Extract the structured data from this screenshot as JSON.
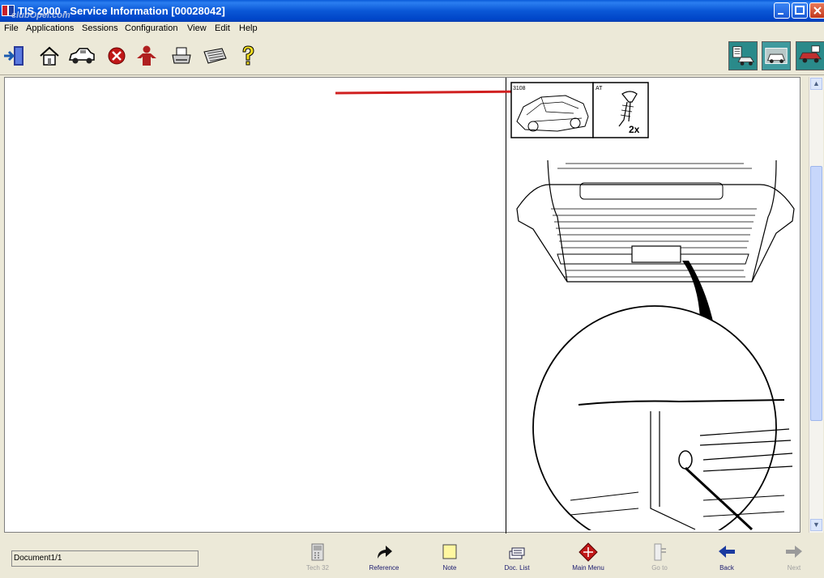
{
  "window": {
    "title": "TIS 2000 - Service Information [00028042]",
    "watermark": "clubOpel.com"
  },
  "menu": [
    "File",
    "Applications",
    "Sessions",
    "Configuration",
    "View",
    "Edit",
    "Help"
  ],
  "toolbar": {
    "buttons": [
      "exit-icon",
      "home-icon",
      "vehicle-icon",
      "stop-icon",
      "person-icon",
      "print-icon",
      "keyboard-icon",
      "help-icon"
    ],
    "mode_buttons": [
      "service-info-icon",
      "vehicle-selection-icon",
      "diagnosis-icon"
    ]
  },
  "drawing": {
    "ref_number": "3108",
    "part_number": "AT",
    "quantity_label": "2x"
  },
  "status": {
    "document": "Document1/1"
  },
  "nav": [
    {
      "label": "Tech 32",
      "enabled": false
    },
    {
      "label": "Reference",
      "enabled": true
    },
    {
      "label": "Note",
      "enabled": true
    },
    {
      "label": "Doc. List",
      "enabled": true
    },
    {
      "label": "Main Menu",
      "enabled": true
    },
    {
      "label": "Go to",
      "enabled": false
    },
    {
      "label": "Back",
      "enabled": true
    },
    {
      "label": "Next",
      "enabled": false
    }
  ],
  "colors": {
    "titlebar": "#0a57d6",
    "arrow": "#d02020",
    "mode_button": "#2a8a8a"
  }
}
